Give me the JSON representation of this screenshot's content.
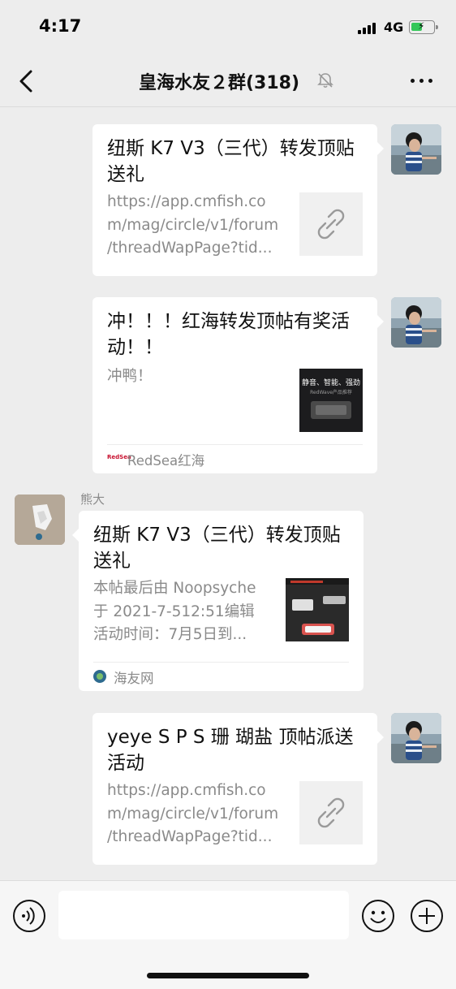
{
  "status_bar": {
    "time": "4:17",
    "network": "4G",
    "battery_level": 0.5,
    "battery_color": "#34c759"
  },
  "nav": {
    "title": "皇海水友２群(318)",
    "back_icon": "chevron-left-icon",
    "mute_icon": "bell-muted-icon",
    "more_icon": "more-dots-icon"
  },
  "messages": [
    {
      "side": "right",
      "title": "纽斯 K7 V3（三代）转发顶贴送礼",
      "desc_lines": [
        "https://app.cmfish.co",
        "m/mag/circle/v1/forum",
        "/threadWapPage?tid..."
      ],
      "thumb": "link-icon"
    },
    {
      "side": "right",
      "title": "冲！！！红海转发顶帖有奖活动！！",
      "desc_lines": [
        "冲鸭！"
      ],
      "thumb_text": "静音、智能、强劲",
      "thumb_subtext": "RedWave产品推荐",
      "source": "RedSea红海",
      "source_logo_text": "RedSea"
    },
    {
      "side": "left",
      "sender": "熊大",
      "title": "纽斯 K7 V3（三代）转发顶贴送礼",
      "desc_lines": [
        "本帖最后由 Noopsyche",
        "于 2021-7-512:51编辑",
        "活动时间：7月5日到..."
      ],
      "thumb": "product-photo",
      "source": "海友网"
    },
    {
      "side": "right",
      "title": "yeye S P S 珊 瑚盐 顶帖派送活动",
      "desc_lines": [
        "https://app.cmfish.co",
        "m/mag/circle/v1/forum",
        "/threadWapPage?tid..."
      ],
      "thumb": "link-icon"
    }
  ],
  "input_bar": {
    "placeholder": "",
    "voice_icon": "voice-icon",
    "emoji_icon": "emoji-icon",
    "plus_icon": "plus-circle-icon"
  }
}
